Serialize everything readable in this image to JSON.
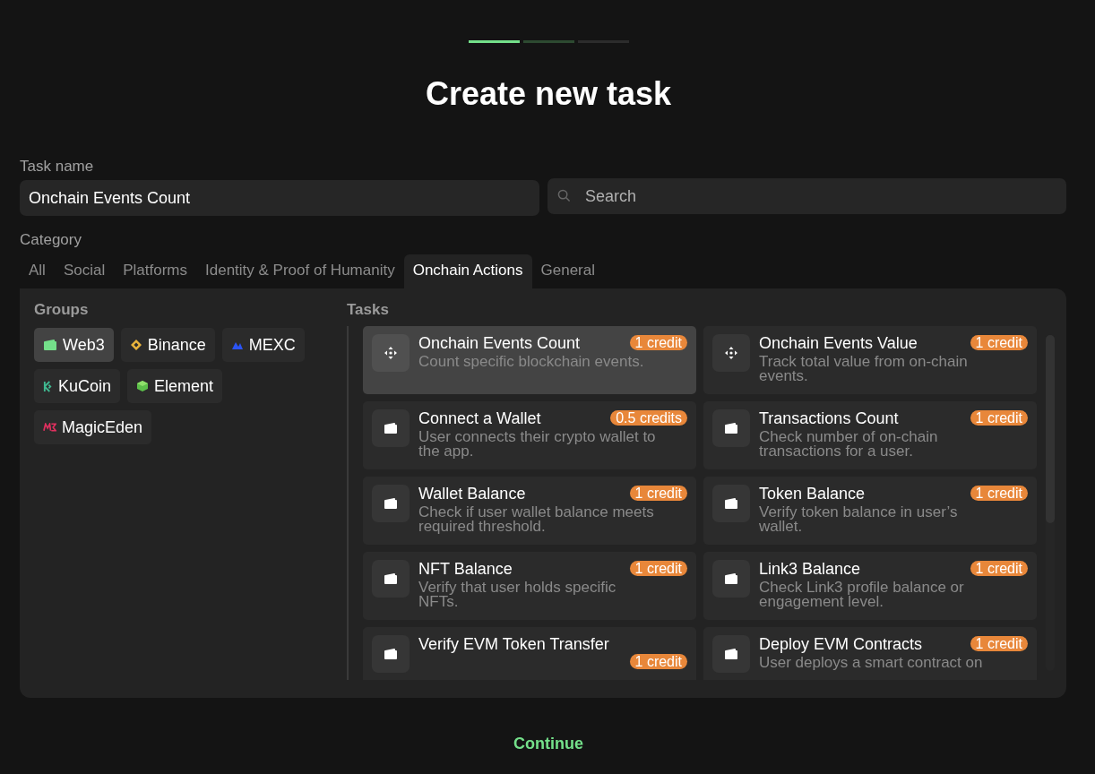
{
  "steps": [
    {
      "kind": "current"
    },
    {
      "kind": "next"
    },
    {
      "kind": "upcoming"
    }
  ],
  "title": "Create new task",
  "task_name": {
    "label": "Task name",
    "value": "Onchain Events Count"
  },
  "search": {
    "placeholder": "Search"
  },
  "category": {
    "label": "Category",
    "tabs": [
      {
        "label": "All",
        "selected": false
      },
      {
        "label": "Social",
        "selected": false
      },
      {
        "label": "Platforms",
        "selected": false
      },
      {
        "label": "Identity & Proof of Humanity",
        "selected": false
      },
      {
        "label": "Onchain Actions",
        "selected": true
      },
      {
        "label": "General",
        "selected": false
      }
    ]
  },
  "groups": {
    "title": "Groups",
    "items": [
      {
        "label": "Web3",
        "kind": "wallet",
        "selected": true
      },
      {
        "label": "Binance",
        "kind": "diamond",
        "selected": false
      },
      {
        "label": "MEXC",
        "kind": "peaks",
        "selected": false
      },
      {
        "label": "KuCoin",
        "kind": "k",
        "selected": false
      },
      {
        "label": "Element",
        "kind": "cube",
        "selected": false
      },
      {
        "label": "MagicEden",
        "kind": "m",
        "selected": false
      }
    ]
  },
  "tasks": {
    "title": "Tasks",
    "items": [
      {
        "title": "Onchain Events Count",
        "credits": "1 credit",
        "description": "Count specific blockchain events.",
        "kind": "move",
        "selected": true
      },
      {
        "title": "Onchain Events Value",
        "credits": "1 credit",
        "description": "Track total value from on-chain events.",
        "kind": "move",
        "selected": false
      },
      {
        "title": "Connect a Wallet",
        "credits": "0.5 credits",
        "description": "User connects their crypto wallet to the app.",
        "kind": "wallet",
        "selected": false
      },
      {
        "title": "Transactions Count",
        "credits": "1 credit",
        "description": "Check number of on-chain transactions for a user.",
        "kind": "wallet",
        "selected": false
      },
      {
        "title": "Wallet Balance",
        "credits": "1 credit",
        "description": "Check if user wallet balance meets required threshold.",
        "kind": "wallet",
        "selected": false
      },
      {
        "title": "Token Balance",
        "credits": "1 credit",
        "description": "Verify token balance in user’s wallet.",
        "kind": "wallet",
        "selected": false
      },
      {
        "title": "NFT Balance",
        "credits": "1 credit",
        "description": "Verify that user holds specific NFTs.",
        "kind": "wallet",
        "selected": false
      },
      {
        "title": "Link3 Balance",
        "credits": "1 credit",
        "description": "Check Link3 profile balance or engagement level.",
        "kind": "wallet",
        "selected": false
      },
      {
        "title": "Verify EVM Token Transfer",
        "credits": "1 credit",
        "kind": "wallet",
        "selected": false
      },
      {
        "title": "Deploy EVM Contracts",
        "credits": "1 credit",
        "description": "User deploys a smart contract on",
        "kind": "wallet",
        "selected": false
      }
    ]
  },
  "continue_button": "Continue"
}
